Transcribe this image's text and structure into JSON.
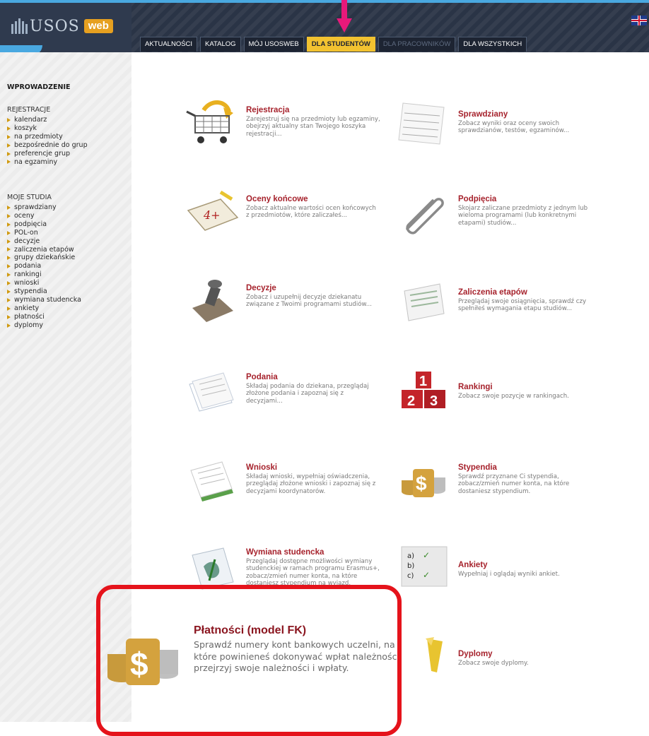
{
  "app": {
    "logo_text": "USOS",
    "logo_badge": "web"
  },
  "tabs": [
    {
      "label": "AKTUALNOŚCI",
      "state": "normal"
    },
    {
      "label": "KATALOG",
      "state": "normal"
    },
    {
      "label": "MÓJ USOSWEB",
      "state": "normal"
    },
    {
      "label": "DLA STUDENTÓW",
      "state": "active"
    },
    {
      "label": "DLA PRACOWNIKÓW",
      "state": "disabled"
    },
    {
      "label": "DLA WSZYSTKICH",
      "state": "normal"
    }
  ],
  "sidebar": {
    "title": "WPROWADZENIE",
    "rejestracje_header": "REJESTRACJE",
    "rejestracje_items": [
      "kalendarz",
      "koszyk",
      "na przedmioty",
      "bezpośrednie do grup",
      "preferencje grup",
      "na egzaminy"
    ],
    "studia_header": "MOJE STUDIA",
    "studia_items": [
      "sprawdziany",
      "oceny",
      "podpięcia",
      "POL-on",
      "decyzje",
      "zaliczenia etapów",
      "grupy dziekańskie",
      "podania",
      "rankingi",
      "wnioski",
      "stypendia",
      "wymiana studencka",
      "ankiety",
      "płatności",
      "dyplomy"
    ]
  },
  "items": {
    "rejestracja": {
      "title": "Rejestracja",
      "desc": "Zarejestruj się na przedmioty lub egzaminy, obejrzyj aktualny stan Twojego koszyka rejestracji..."
    },
    "sprawdziany": {
      "title": "Sprawdziany",
      "desc": "Zobacz wyniki oraz oceny swoich sprawdzianów, testów, egzaminów..."
    },
    "oceny": {
      "title": "Oceny końcowe",
      "desc": "Zobacz aktualne wartości ocen końcowych z przedmiotów, które zaliczałeś..."
    },
    "podpiecia": {
      "title": "Podpięcia",
      "desc": "Skojarz zaliczane przedmioty z jednym lub wieloma programami (lub konkretnymi etapami) studiów..."
    },
    "decyzje": {
      "title": "Decyzje",
      "desc": "Zobacz i uzupełnij decyzje dziekanatu związane z Twoimi programami studiów..."
    },
    "zaliczenia": {
      "title": "Zaliczenia etapów",
      "desc": "Przeglądaj swoje osiągnięcia, sprawdź czy spełniłeś wymagania etapu studiów..."
    },
    "podania": {
      "title": "Podania",
      "desc": "Składaj podania do dziekana, przeglądaj złożone podania i zapoznaj się z decyzjami..."
    },
    "rankingi": {
      "title": "Rankingi",
      "desc": "Zobacz swoje pozycje w rankingach."
    },
    "wnioski": {
      "title": "Wnioski",
      "desc": "Składaj wnioski, wypełniaj oświadczenia, przeglądaj złożone wnioski i zapoznaj się z decyzjami koordynatorów."
    },
    "stypendia": {
      "title": "Stypendia",
      "desc": "Sprawdź przyznane Ci stypendia, zobacz/zmień numer konta, na które dostaniesz stypendium."
    },
    "wymiana": {
      "title": "Wymiana studencka",
      "desc": "Przeglądaj dostępne możliwości wymiany studenckiej w ramach programu Erasmus+, zobacz/zmień numer konta, na które dostaniesz stypendium na wyjazd."
    },
    "ankiety": {
      "title": "Ankiety",
      "desc": "Wypełniaj i oglądaj wyniki ankiet."
    },
    "platnosci": {
      "title": "Płatności (model FK)",
      "desc": "Sprawdź numery kont bankowych uczelni, na które powinieneś dokonywać wpłat należności, przejrzyj swoje należności i wpłaty."
    },
    "dyplomy": {
      "title": "Dyplomy",
      "desc": "Zobacz swoje dyplomy."
    }
  },
  "icons": {
    "ranking_digits": [
      "1",
      "2",
      "3"
    ],
    "ankiety_marks": [
      "a)",
      "b)",
      "c)"
    ],
    "grade_text": "4+"
  },
  "colors": {
    "accent": "#f2c230",
    "title_red": "#a6222c",
    "highlight": "#e5131b",
    "arrow": "#e8197a",
    "topbar": "#2a3446"
  }
}
